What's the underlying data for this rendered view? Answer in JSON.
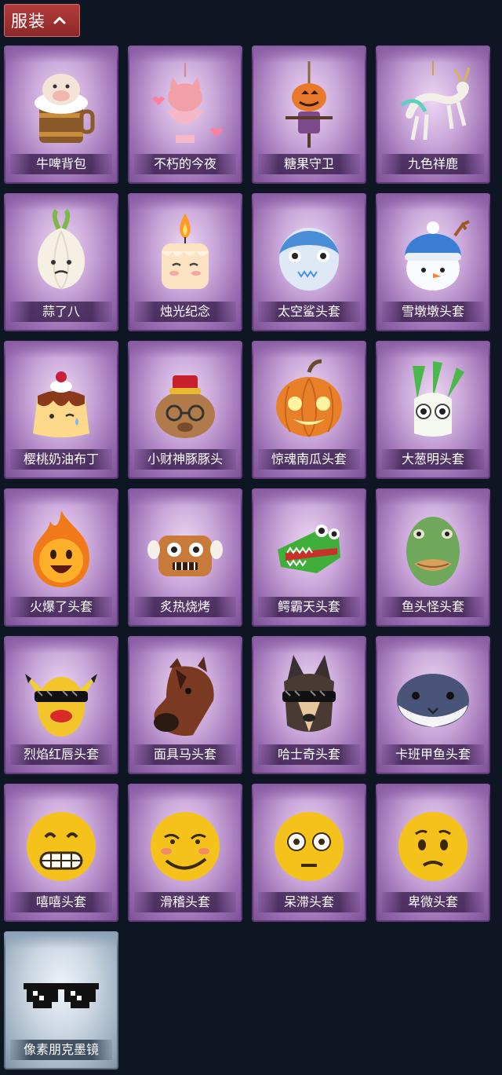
{
  "section": {
    "title": "服装"
  },
  "items": [
    {
      "name": "牛啤背包",
      "icon": "cow-beer-backpack-icon"
    },
    {
      "name": "不朽的今夜",
      "icon": "cat-heart-pendant-icon"
    },
    {
      "name": "糖果守卫",
      "icon": "pumpkin-scarecrow-pendant-icon"
    },
    {
      "name": "九色祥鹿",
      "icon": "nine-color-deer-pendant-icon"
    },
    {
      "name": "蒜了八",
      "icon": "garlic-head-icon"
    },
    {
      "name": "烛光纪念",
      "icon": "candle-head-icon"
    },
    {
      "name": "太空鲨头套",
      "icon": "space-shark-head-icon"
    },
    {
      "name": "雪墩墩头套",
      "icon": "snowman-head-icon"
    },
    {
      "name": "樱桃奶油布丁",
      "icon": "cherry-pudding-head-icon"
    },
    {
      "name": "小财神豚豚头",
      "icon": "capybara-god-of-wealth-head-icon"
    },
    {
      "name": "惊魂南瓜头套",
      "icon": "pumpkin-head-icon"
    },
    {
      "name": "大葱明头套",
      "icon": "scallion-head-icon"
    },
    {
      "name": "火爆了头套",
      "icon": "fire-head-icon"
    },
    {
      "name": "炙热烧烤",
      "icon": "grilled-meat-head-icon"
    },
    {
      "name": "鳄霸天头套",
      "icon": "crocodile-head-icon"
    },
    {
      "name": "鱼头怪头套",
      "icon": "fish-head-icon"
    },
    {
      "name": "烈焰红唇头套",
      "icon": "pikachu-lips-head-icon"
    },
    {
      "name": "面具马头套",
      "icon": "horse-mask-head-icon"
    },
    {
      "name": "哈士奇头套",
      "icon": "husky-head-icon"
    },
    {
      "name": "卡班甲鱼头套",
      "icon": "turtle-fish-head-icon"
    },
    {
      "name": "嘻嘻头套",
      "icon": "grin-emoji-head-icon"
    },
    {
      "name": "滑稽头套",
      "icon": "smirk-emoji-head-icon"
    },
    {
      "name": "呆滞头套",
      "icon": "stunned-emoji-head-icon"
    },
    {
      "name": "卑微头套",
      "icon": "pleading-emoji-head-icon"
    },
    {
      "name": "像素朋克墨镜",
      "icon": "pixel-sunglasses-icon"
    }
  ]
}
